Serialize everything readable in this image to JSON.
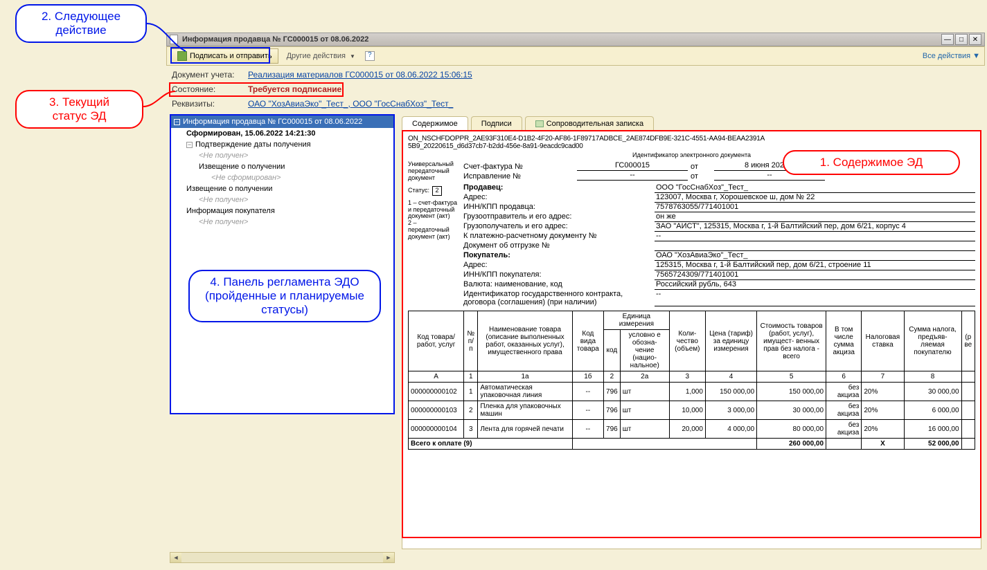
{
  "callouts": {
    "c2": "2. Следующее\nдействие",
    "c3": "3. Текущий\nстатус ЭД",
    "c4": "4. Панель регламента ЭДО\n(пройденные и планируемые\nстатусы)",
    "c1": "1. Содержимое ЭД"
  },
  "window": {
    "title": "Информация продавца № ГС000015 от 08.06.2022"
  },
  "toolbar": {
    "sign_send": "Подписать и отправить",
    "other": "Другие действия",
    "all_actions": "Все действия"
  },
  "info": {
    "doc_lbl": "Документ учета:",
    "doc_link": "Реализация материалов ГС000015 от 08.06.2022 15:06:15",
    "state_lbl": "Состояние:",
    "state_val": "Требуется подписание",
    "req_lbl": "Реквизиты:",
    "req_link": "ОАО \"ХозАвиаЭко\"_Тест_, ООО \"ГосСнабХоз\"_Тест_"
  },
  "tree": {
    "hdr": "Информация продавца № ГС000015 от 08.06.2022",
    "r1": "Сформирован, 15.06.2022 14:21:30",
    "r2": "Подтверждение даты получения",
    "r3": "<Не получен>",
    "r4": "Извещение о получении",
    "r5": "<Не сформирован>",
    "r6": "Извещение о получении",
    "r7": "<Не получен>",
    "r8": "Информация покупателя",
    "r9": "<Не получен>"
  },
  "tabs": {
    "t1": "Содержимое",
    "t2": "Подписи",
    "t3": "Сопроводительная записка"
  },
  "doc": {
    "fileid1": "ON_NSCHFDOPPR_2AE93F310E4-D1B2-4F20-AF86-1F89717ADBCE_2AE874DFB9E-321C-4551-AA94-BEAA2391A",
    "fileid2": "5B9_20220615_d6d37cb7-b2dd-456e-8a91-9eacdc9cad00",
    "idlabel": "Идентификатор электронного документа",
    "left_lbl1": "Универсальный передаточный документ",
    "status_lbl": "Статус:",
    "status_val": "2",
    "left_lbl2": "1 – счет-фактура и передаточный документ (акт)\n2 – передаточный документ (акт)",
    "sf_lbl": "Счет-фактура №",
    "sf_no": "ГС000015",
    "sf_date_lbl": "от",
    "sf_date": "8 июня 2022 г.",
    "fix_lbl": "Исправление №",
    "fix_no": "--",
    "fix_date_lbl": "от",
    "fix_date": "--",
    "rows": [
      {
        "l": "Продавец:",
        "v": "ООО \"ГосСнабХоз\"_Тест_",
        "b": true
      },
      {
        "l": "Адрес:",
        "v": "123007, Москва г, Хорошевское ш, дом № 22"
      },
      {
        "l": "ИНН/КПП продавца:",
        "v": "7578763055/771401001"
      },
      {
        "l": "Грузоотправитель и его адрес:",
        "v": "он же"
      },
      {
        "l": "Грузополучатель и его адрес:",
        "v": "ЗАО \"АИСТ\", 125315, Москва г, 1-й Балтийский пер, дом 6/21, корпус 4"
      },
      {
        "l": "К платежно-расчетному документу №",
        "v": "--"
      },
      {
        "l": "Документ об отгрузке №",
        "v": ""
      },
      {
        "l": "Покупатель:",
        "v": "ОАО \"ХозАвиаЭко\"_Тест_",
        "b": true
      },
      {
        "l": "Адрес:",
        "v": "125315, Москва г, 1-й Балтийский пер, дом 6/21, строение 11"
      },
      {
        "l": "ИНН/КПП покупателя:",
        "v": "7565724309/771401001"
      },
      {
        "l": "Валюта: наименование, код",
        "v": "Российский рубль, 643"
      },
      {
        "l": "Идентификатор государственного контракта, договора (соглашения) (при наличии)",
        "v": "--"
      }
    ],
    "thead": {
      "c1": "Код товара/ работ, услуг",
      "c2": "№ п/п",
      "c3": "Наименование товара (описание выполненных работ, оказанных услуг), имущественного права",
      "c4": "Код вида товара",
      "c5": "Единица измерения",
      "c5a": "код",
      "c5b": "условно е обозна- чение (нацио- нальное)",
      "c6": "Коли- чество (объем)",
      "c7": "Цена (тариф) за единицу измерения",
      "c8": "Стоимость товаров (работ, услуг), имущест- венных прав без налога - всего",
      "c9": "В том числе сумма акциза",
      "c10": "Налоговая ставка",
      "c11": "Сумма налога, предъяв- ляемая покупателю",
      "c12": "(р ве"
    },
    "trow2": {
      "a": "А",
      "b": "1",
      "c": "1а",
      "d": "1б",
      "e": "2",
      "f": "2а",
      "g": "3",
      "h": "4",
      "i": "5",
      "j": "6",
      "k": "7",
      "l": "8"
    },
    "items": [
      {
        "code": "000000000102",
        "n": "1",
        "name": "Автоматическая упаковочная линия",
        "kind": "--",
        "uc": "796",
        "un": "шт",
        "qty": "1,000",
        "price": "150 000,00",
        "sum": "150 000,00",
        "ak": "без акциза",
        "rate": "20%",
        "tax": "30 000,00"
      },
      {
        "code": "000000000103",
        "n": "2",
        "name": "Пленка для упаковочных машин",
        "kind": "--",
        "uc": "796",
        "un": "шт",
        "qty": "10,000",
        "price": "3 000,00",
        "sum": "30 000,00",
        "ak": "без акциза",
        "rate": "20%",
        "tax": "6 000,00"
      },
      {
        "code": "000000000104",
        "n": "3",
        "name": "Лента для горячей печати",
        "kind": "--",
        "uc": "796",
        "un": "шт",
        "qty": "20,000",
        "price": "4 000,00",
        "sum": "80 000,00",
        "ak": "без акциза",
        "rate": "20%",
        "tax": "16 000,00"
      }
    ],
    "total_lbl": "Всего к оплате (9)",
    "total_sum": "260 000,00",
    "total_x": "X",
    "total_tax": "52 000,00"
  }
}
